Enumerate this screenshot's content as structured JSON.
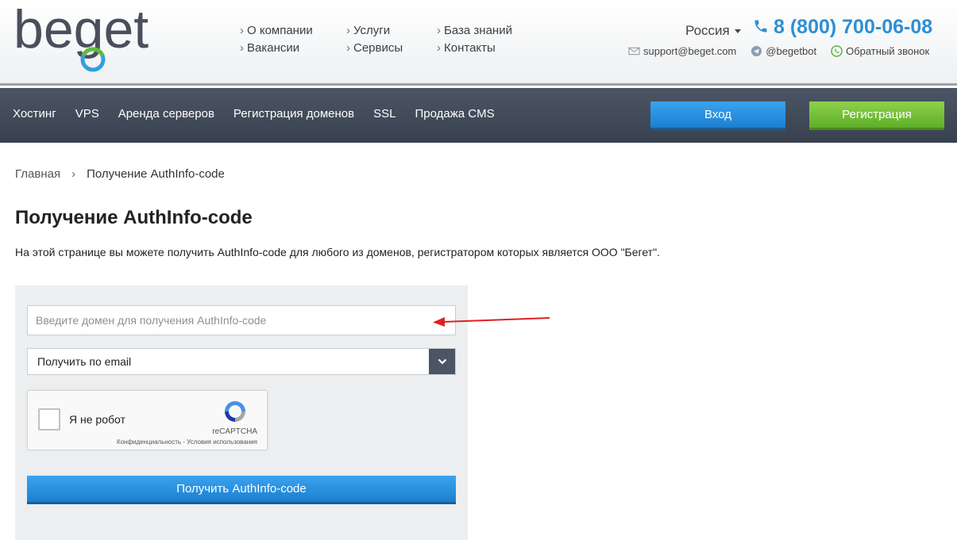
{
  "header": {
    "logo_text": "beget",
    "links": [
      {
        "label": "О компании"
      },
      {
        "label": "Услуги"
      },
      {
        "label": "База знаний"
      },
      {
        "label": "Вакансии"
      },
      {
        "label": "Сервисы"
      },
      {
        "label": "Контакты"
      }
    ],
    "region": "Россия",
    "phone": "8 (800) 700-06-08",
    "email": "support@beget.com",
    "telegram": "@begetbot",
    "callback": "Обратный звонок"
  },
  "nav": {
    "items": [
      {
        "label": "Хостинг"
      },
      {
        "label": "VPS"
      },
      {
        "label": "Аренда серверов"
      },
      {
        "label": "Регистрация доменов"
      },
      {
        "label": "SSL"
      },
      {
        "label": "Продажа CMS"
      }
    ],
    "login_label": "Вход",
    "register_label": "Регистрация"
  },
  "breadcrumb": {
    "home": "Главная",
    "separator": "›",
    "current": "Получение AuthInfo-code"
  },
  "page": {
    "title": "Получение AuthInfo-code",
    "description": "На этой странице вы можете получить AuthInfo-code для любого из доменов, регистратором которых является ООО \"Бегет\"."
  },
  "form": {
    "domain_placeholder": "Введите домен для получения AuthInfo-code",
    "domain_value": "",
    "delivery_selected": "Получить по email",
    "recaptcha_label": "Я не робот",
    "recaptcha_brand": "reCAPTCHA",
    "recaptcha_terms": "Конфиденциальность - Условия использования",
    "submit_label": "Получить AuthInfo-code"
  },
  "colors": {
    "accent_blue": "#2f8fd4",
    "nav_bg": "#434b58",
    "register_green": "#6cbd30",
    "annotation_arrow": "#e02020"
  }
}
